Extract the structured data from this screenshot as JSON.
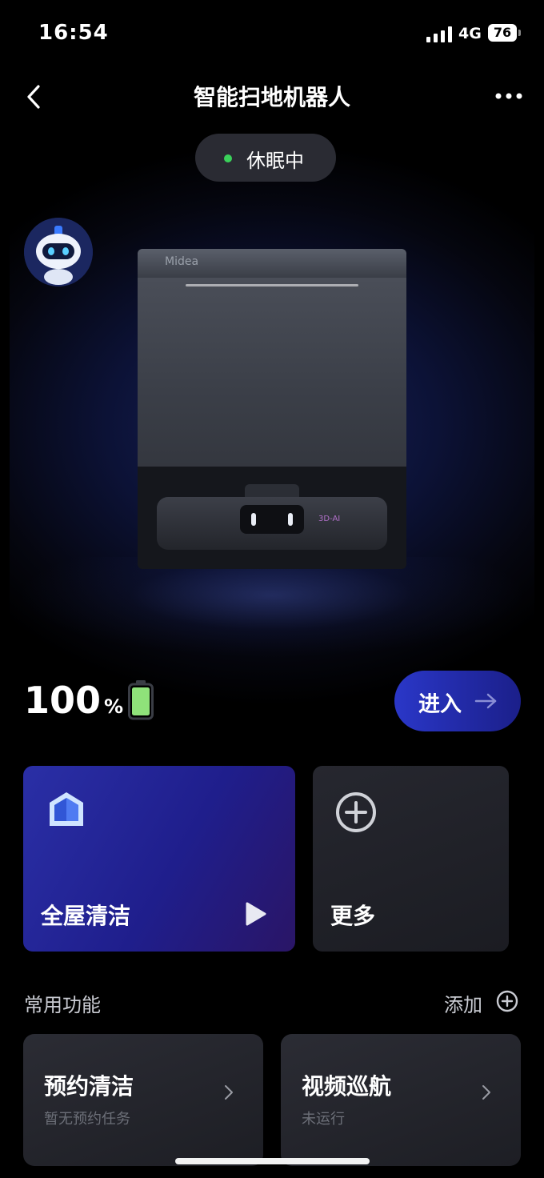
{
  "status_bar": {
    "time": "16:54",
    "network": "4G",
    "battery": "76"
  },
  "nav": {
    "title": "智能扫地机器人",
    "back_icon": "chevron-left-icon",
    "more_icon": "ellipsis-icon"
  },
  "device": {
    "state": "休眠中",
    "state_color": "#3ad15a",
    "brand_logo": "Midea",
    "model_tag": "3D-AI"
  },
  "battery": {
    "value": "100",
    "unit": "%",
    "level": 1.0,
    "color": "#8fe27a"
  },
  "enter": {
    "label": "进入"
  },
  "cards": {
    "clean": {
      "label": "全屋清洁",
      "icon": "house-icon"
    },
    "more": {
      "label": "更多",
      "icon": "plus-circle-icon"
    }
  },
  "common": {
    "title": "常用功能",
    "add_label": "添加"
  },
  "functions": [
    {
      "title": "预约清洁",
      "subtitle": "暂无预约任务"
    },
    {
      "title": "视频巡航",
      "subtitle": "未运行"
    }
  ],
  "colors": {
    "accent": "#2a37c8",
    "background": "#000000"
  }
}
